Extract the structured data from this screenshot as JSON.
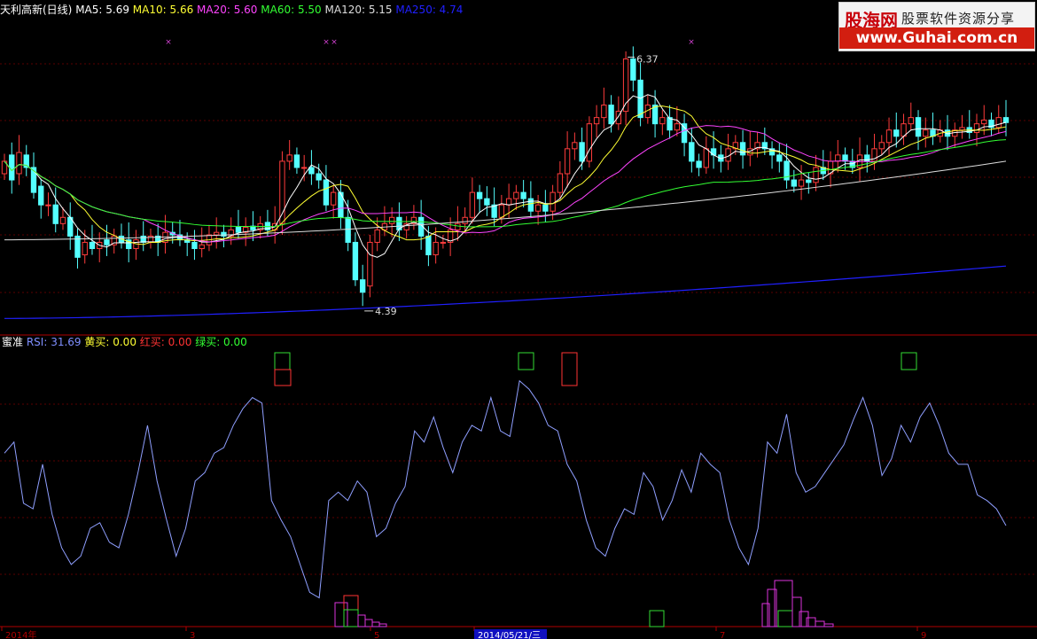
{
  "stock": {
    "name": "天利高新(日线)",
    "ma": [
      {
        "label": "MA5:",
        "value": "5.69",
        "color": "#ffffff"
      },
      {
        "label": "MA10:",
        "value": "5.66",
        "color": "#ffff33"
      },
      {
        "label": "MA20:",
        "value": "5.60",
        "color": "#ff44ff"
      },
      {
        "label": "MA60:",
        "value": "5.50",
        "color": "#33ff33"
      },
      {
        "label": "MA120:",
        "value": "5.15",
        "color": "#dddddd"
      },
      {
        "label": "MA250:",
        "value": "4.74",
        "color": "#2020ff"
      }
    ]
  },
  "indicator": {
    "name": "蜜准",
    "items": [
      {
        "label": "RSI:",
        "value": "31.69",
        "color": "#7f8fff"
      },
      {
        "label": "黄买:",
        "value": "0.00",
        "color": "#ffff33"
      },
      {
        "label": "红买:",
        "value": "0.00",
        "color": "#ff3333"
      },
      {
        "label": "绿买:",
        "value": "0.00",
        "color": "#33ff33"
      }
    ]
  },
  "watermark": {
    "title": "股海网",
    "slogan": "股票软件资源分享",
    "url": "www.Guhai.com.cn"
  },
  "axis_labels": [
    "2014年",
    "3",
    "5",
    "2014/05/21/三",
    "7",
    "9"
  ],
  "chart_data": [
    {
      "type": "candlestick",
      "title": "天利高新(日线)",
      "annotations": [
        {
          "label": "6.37",
          "kind": "high"
        },
        {
          "label": "4.39",
          "kind": "low"
        }
      ],
      "x": [
        "2014年",
        "3",
        "5",
        "2014/05/21/三",
        "7",
        "9"
      ],
      "ylim": [
        4.2,
        6.7
      ],
      "close": [
        5.55,
        5.4,
        5.62,
        5.5,
        5.3,
        5.2,
        5.2,
        5.05,
        5.1,
        4.95,
        4.78,
        4.9,
        4.85,
        4.9,
        4.88,
        4.95,
        4.9,
        4.85,
        4.92,
        4.9,
        4.95,
        4.9,
        4.98,
        4.96,
        4.92,
        4.9,
        4.85,
        4.88,
        4.96,
        4.98,
        4.95,
        5.0,
        4.98,
        5.02,
        5.0,
        5.05,
        5.0,
        5.05,
        5.55,
        5.6,
        5.5,
        5.5,
        5.45,
        5.4,
        5.2,
        5.3,
        5.1,
        4.9,
        4.6,
        4.5,
        4.9,
        5.0,
        5.05,
        5.1,
        5.0,
        5.05,
        5.1,
        4.95,
        4.8,
        4.9,
        4.9,
        5.0,
        5.05,
        5.1,
        5.3,
        5.25,
        5.2,
        5.1,
        5.2,
        5.25,
        5.3,
        5.25,
        5.15,
        5.2,
        5.15,
        5.3,
        5.45,
        5.65,
        5.7,
        5.55,
        5.85,
        5.9,
        6.0,
        5.85,
        5.95,
        6.37,
        6.2,
        5.9,
        6.0,
        5.85,
        5.9,
        5.8,
        5.85,
        5.7,
        5.55,
        5.5,
        5.65,
        5.6,
        5.55,
        5.65,
        5.7,
        5.6,
        5.65,
        5.7,
        5.65,
        5.6,
        5.55,
        5.4,
        5.35,
        5.4,
        5.38,
        5.5,
        5.45,
        5.55,
        5.6,
        5.55,
        5.5,
        5.6,
        5.55,
        5.65,
        5.7,
        5.8,
        5.75,
        5.85,
        5.9,
        5.75,
        5.8,
        5.75,
        5.8,
        5.75,
        5.8,
        5.82,
        5.78,
        5.85,
        5.88,
        5.82,
        5.9,
        5.86
      ],
      "open": [
        5.45,
        5.6,
        5.45,
        5.6,
        5.5,
        5.35,
        5.2,
        5.2,
        5.05,
        5.1,
        4.95,
        4.8,
        4.9,
        4.85,
        4.92,
        4.88,
        4.95,
        4.92,
        4.85,
        4.95,
        4.9,
        4.95,
        4.9,
        4.98,
        4.96,
        4.92,
        4.9,
        4.85,
        4.88,
        4.96,
        4.98,
        4.95,
        5.02,
        4.98,
        5.03,
        5.0,
        5.06,
        5.0,
        5.05,
        5.55,
        5.6,
        5.5,
        5.5,
        5.45,
        5.4,
        5.2,
        5.3,
        5.1,
        4.9,
        4.6,
        4.55,
        4.9,
        5.0,
        5.05,
        5.1,
        5.0,
        5.05,
        5.1,
        4.95,
        4.8,
        4.9,
        4.9,
        5.0,
        5.05,
        5.1,
        5.3,
        5.25,
        5.2,
        5.1,
        5.2,
        5.25,
        5.3,
        5.25,
        5.15,
        5.2,
        5.15,
        5.3,
        5.45,
        5.65,
        5.7,
        5.55,
        5.85,
        5.9,
        6.0,
        5.85,
        5.95,
        6.37,
        6.2,
        5.9,
        6.0,
        5.85,
        5.9,
        5.8,
        5.85,
        5.7,
        5.55,
        5.5,
        5.65,
        5.6,
        5.55,
        5.65,
        5.7,
        5.6,
        5.65,
        5.7,
        5.65,
        5.6,
        5.55,
        5.4,
        5.35,
        5.4,
        5.38,
        5.5,
        5.45,
        5.55,
        5.6,
        5.55,
        5.5,
        5.6,
        5.55,
        5.65,
        5.7,
        5.8,
        5.75,
        5.85,
        5.9,
        5.75,
        5.8,
        5.75,
        5.8,
        5.75,
        5.8,
        5.82,
        5.78,
        5.85,
        5.88,
        5.82,
        5.9
      ]
    },
    {
      "type": "line",
      "title": "RSI",
      "ylim": [
        0,
        100
      ],
      "series": [
        {
          "name": "RSI",
          "values": [
            62,
            66,
            44,
            42,
            58,
            40,
            28,
            22,
            25,
            35,
            37,
            30,
            28,
            40,
            55,
            72,
            52,
            38,
            25,
            35,
            52,
            55,
            62,
            64,
            72,
            78,
            82,
            80,
            45,
            38,
            32,
            22,
            12,
            10,
            45,
            48,
            45,
            52,
            48,
            32,
            35,
            44,
            50,
            70,
            66,
            75,
            64,
            55,
            66,
            72,
            70,
            82,
            70,
            68,
            88,
            85,
            80,
            72,
            70,
            58,
            52,
            38,
            28,
            25,
            35,
            42,
            40,
            55,
            50,
            38,
            45,
            56,
            48,
            62,
            58,
            55,
            38,
            28,
            22,
            35,
            66,
            62,
            76,
            55,
            48,
            50,
            55,
            60,
            65,
            74,
            82,
            72,
            54,
            60,
            72,
            66,
            75,
            80,
            72,
            62,
            58,
            58,
            47,
            45,
            42,
            36
          ]
        }
      ]
    }
  ]
}
